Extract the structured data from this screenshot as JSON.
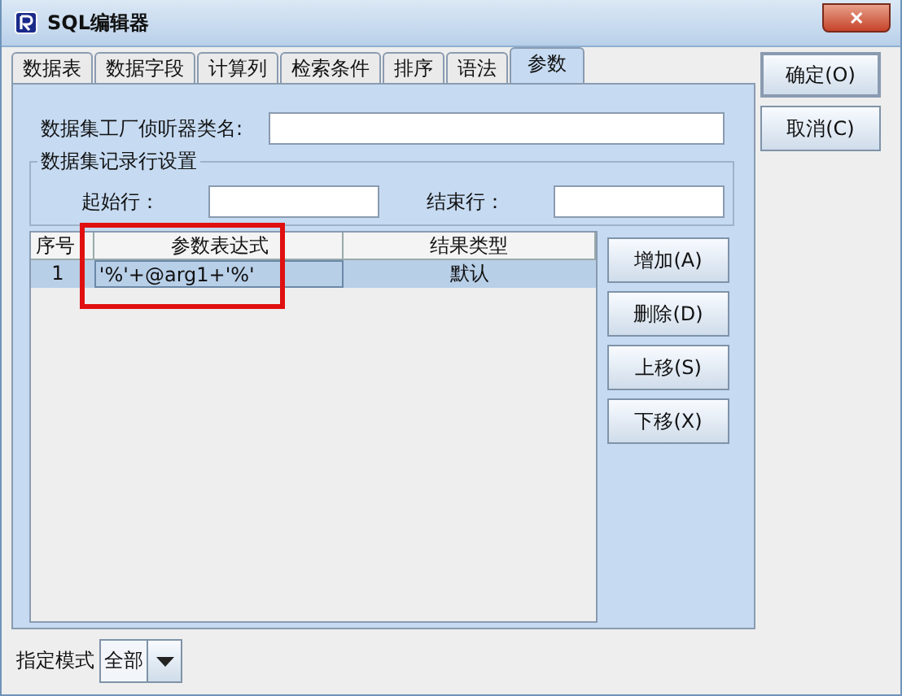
{
  "window": {
    "title": "SQL编辑器",
    "close": "✕"
  },
  "tabs": [
    {
      "label": "数据表",
      "selected": false
    },
    {
      "label": "数据字段",
      "selected": false
    },
    {
      "label": "计算列",
      "selected": false
    },
    {
      "label": "检索条件",
      "selected": false
    },
    {
      "label": "排序",
      "selected": false
    },
    {
      "label": "语法",
      "selected": false
    },
    {
      "label": "参数",
      "selected": true
    }
  ],
  "listener": {
    "label": "数据集工厂侦听器类名:"
  },
  "row_settings": {
    "legend": "数据集记录行设置",
    "start_label": "起始行：",
    "end_label": "结束行："
  },
  "table": {
    "columns": [
      "序号",
      "参数表达式",
      "结果类型"
    ],
    "rows": [
      {
        "cells": [
          "1",
          "'%'+@arg1+'%'",
          "默认"
        ],
        "selected": true
      }
    ]
  },
  "table_buttons": [
    "增加(A)",
    "删除(D)",
    "上移(S)",
    "下移(X)"
  ],
  "dialog_buttons": [
    {
      "label": "确定(O)",
      "default": true
    },
    {
      "label": "取消(C)",
      "default": false
    }
  ],
  "mode": {
    "label": "指定模式",
    "value": "全部"
  },
  "annotations": [
    {
      "kind": "rectangle",
      "color": "#e01010"
    }
  ]
}
